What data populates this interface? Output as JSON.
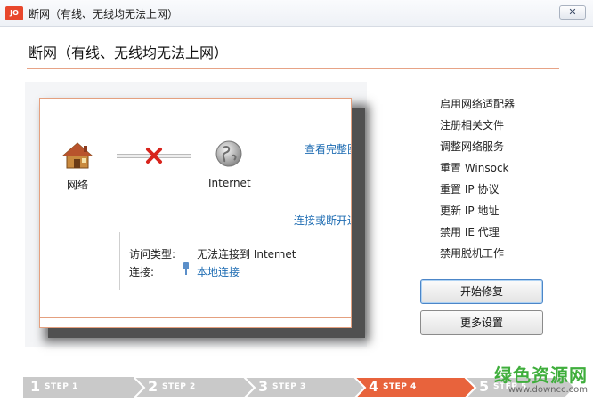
{
  "window": {
    "app_icon_text": "JO",
    "title": "断网（有线、无线均无法上网）",
    "close_label": "✕"
  },
  "page_title": "断网（有线、无线均无法上网）",
  "diagram": {
    "node_local": "网络",
    "node_internet": "Internet",
    "view_full_link": "查看完整图",
    "connect_link": "连接或断开连接",
    "access_type_label": "访问类型:",
    "access_type_value": "无法连接到 Internet",
    "connection_label": "连接:",
    "connection_value": "本地连接"
  },
  "actions": {
    "items": [
      "启用网络适配器",
      "注册相关文件",
      "调整网络服务",
      "重置 Winsock",
      "重置 IP 协议",
      "更新 IP 地址",
      "禁用 IE 代理",
      "禁用脱机工作"
    ],
    "start_repair": "开始修复",
    "more_settings": "更多设置"
  },
  "steps": [
    {
      "num": "1",
      "label": "STEP 1",
      "active": false
    },
    {
      "num": "2",
      "label": "STEP 2",
      "active": false
    },
    {
      "num": "3",
      "label": "STEP 3",
      "active": false
    },
    {
      "num": "4",
      "label": "STEP 4",
      "active": true
    },
    {
      "num": "5",
      "label": "STEP 5",
      "active": false
    }
  ],
  "colors": {
    "accent": "#e8633c",
    "inactive_step": "#c9c9c9",
    "link": "#1f6db3"
  },
  "watermark": {
    "main": "绿色资源网",
    "sub": "www.downcc.com"
  }
}
